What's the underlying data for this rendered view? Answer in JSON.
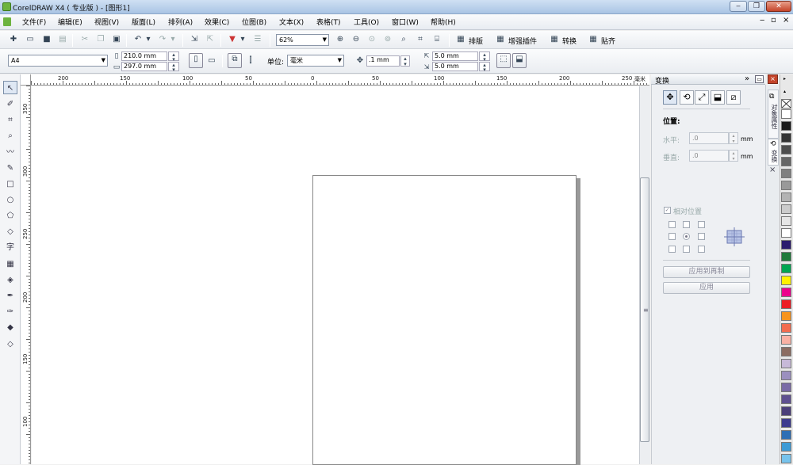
{
  "window": {
    "title": "CorelDRAW X4 ( 专业版 ) - [图形1]",
    "controls": [
      "‒",
      "❐",
      "✕"
    ]
  },
  "menu": {
    "items": [
      "文件(F)",
      "编辑(E)",
      "视图(V)",
      "版面(L)",
      "排列(A)",
      "效果(C)",
      "位图(B)",
      "文本(X)",
      "表格(T)",
      "工具(O)",
      "窗口(W)",
      "帮助(H)"
    ],
    "doc_controls": [
      "‒",
      "▫",
      "×"
    ]
  },
  "toolbar": {
    "zoom": "62%",
    "layout": "排版",
    "plugins": "增强插件",
    "convert": "转换",
    "paste": "贴齐"
  },
  "property_bar": {
    "paper": "A4",
    "width": "210.0 mm",
    "height": "297.0 mm",
    "unit_label": "单位:",
    "unit": "毫米",
    "nudge": ".1 mm",
    "dup_x": "5.0 mm",
    "dup_y": "5.0 mm"
  },
  "ruler": {
    "top_labels": [
      "200",
      "150",
      "100",
      "50",
      "0",
      "50",
      "100",
      "150",
      "200",
      "250"
    ],
    "unit": "毫米",
    "left_labels": [
      "350",
      "300",
      "250",
      "200",
      "150",
      "100"
    ]
  },
  "docker": {
    "title": "变换",
    "position_label": "位置:",
    "horizontal_label": "水平:",
    "horizontal_value": ".0",
    "vertical_label": "垂直:",
    "vertical_value": ".0",
    "unit": "mm",
    "relative_label": "相对位置",
    "apply_dup": "应用到再制",
    "apply": "应用",
    "tab_object": "对象属性",
    "tab_transform": "变换"
  },
  "palette": {
    "colors": [
      "#ffffff",
      "#1a1a1a",
      "#333333",
      "#4d4d4d",
      "#666666",
      "#808080",
      "#999999",
      "#b3b3b3",
      "#cccccc",
      "#e6e6e6",
      "#ffffff",
      "#2a1b6e",
      "#1f7a3a",
      "#00a651",
      "#fff200",
      "#ec008c",
      "#ed1c24",
      "#f7941d",
      "#f26c4f",
      "#f9b1a4",
      "#8c6d62",
      "#c7b9d8",
      "#9b8fbf",
      "#7a6aa6",
      "#5f5090",
      "#4b3f7a",
      "#3c3a8f",
      "#2e6fb5",
      "#3d9bd6",
      "#77c3ec"
    ]
  }
}
